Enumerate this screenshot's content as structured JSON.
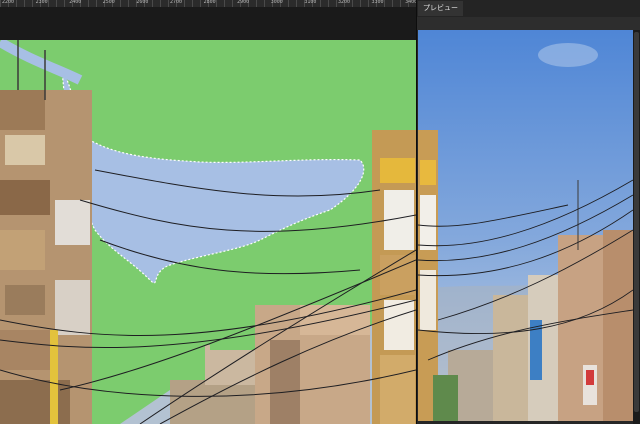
{
  "ruler": {
    "labels": [
      "2200",
      "2300",
      "2400",
      "2500",
      "2600",
      "2700",
      "2800",
      "2900",
      "3000",
      "3100",
      "3200",
      "3300",
      "3400"
    ]
  },
  "panel": {
    "tab_label": "プレビュー"
  },
  "colors": {
    "mask_overlay": "#7ccc6e",
    "sky": "#5d8fd8",
    "background": "#1c1c1c",
    "panel": "#262626"
  },
  "icons": [
    "selection-marquee",
    "scroll-thumb"
  ]
}
